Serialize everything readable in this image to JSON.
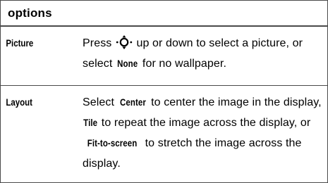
{
  "table": {
    "header": "options",
    "rows": [
      {
        "term": "Picture",
        "desc_prefix": "Press ",
        "icon": "navigation-key-icon",
        "desc_after_icon": " up or down to select a picture, or select ",
        "kw_none": "None",
        "desc_suffix": " for no wallpaper."
      },
      {
        "term": "Layout",
        "desc_1": "Select ",
        "kw_center": "Center",
        "desc_2": " to center the image in the display, ",
        "kw_tile": "Tile",
        "desc_3": " to repeat the image across the display, or ",
        "kw_fit": "Fit-to-screen",
        "desc_4": " to stretch the image across the display."
      }
    ]
  }
}
